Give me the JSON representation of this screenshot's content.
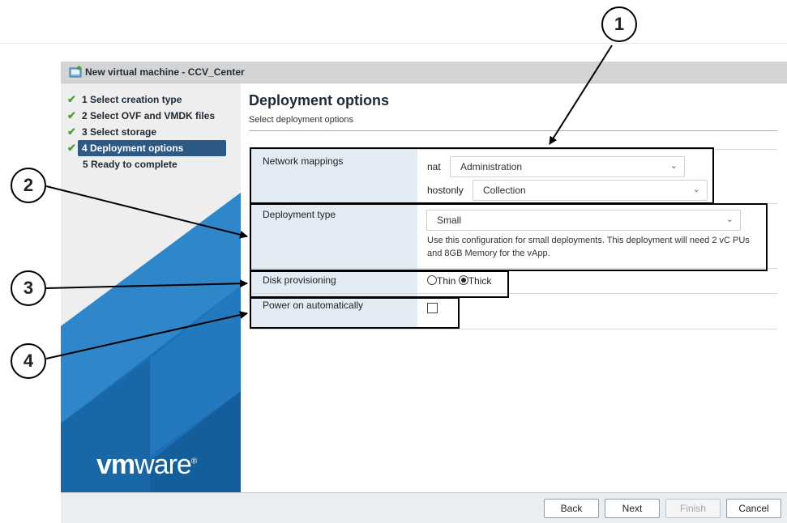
{
  "window": {
    "title": "New virtual machine - CCV_Center"
  },
  "steps": [
    {
      "label": "1 Select creation type",
      "state": "done"
    },
    {
      "label": "2 Select OVF and VMDK files",
      "state": "done"
    },
    {
      "label": "3 Select storage",
      "state": "done"
    },
    {
      "label": "4 Deployment options",
      "state": "active"
    },
    {
      "label": "5 Ready to complete",
      "state": "pending"
    }
  ],
  "brand": {
    "logo_vm": "vm",
    "logo_ware": "ware",
    "logo_reg": "®"
  },
  "page": {
    "title": "Deployment options",
    "subtitle": "Select deployment options"
  },
  "network": {
    "label": "Network mappings",
    "mappings": [
      {
        "name": "nat",
        "value": "Administration"
      },
      {
        "name": "hostonly",
        "value": "Collection"
      }
    ]
  },
  "deployment": {
    "label": "Deployment type",
    "value": "Small",
    "description": "Use this configuration for small deployments. This deployment will need 2 vC PUs and 8GB Memory for the vApp."
  },
  "disk": {
    "label": "Disk provisioning",
    "options": [
      "Thin",
      "Thick"
    ],
    "selected": "Thick"
  },
  "power": {
    "label": "Power on automatically",
    "checked": false
  },
  "buttons": {
    "back": "Back",
    "next": "Next",
    "finish": "Finish",
    "cancel": "Cancel"
  },
  "callouts": [
    "1",
    "2",
    "3",
    "4"
  ],
  "icons": {
    "check": "check-icon",
    "chevron": "chevron-down-icon",
    "window": "vm-window-icon"
  },
  "colors": {
    "active_step": "#2c5a85",
    "check": "#4aa02c",
    "label_bg": "#e3ecf5",
    "brand_blue": "#1c6fb5"
  }
}
